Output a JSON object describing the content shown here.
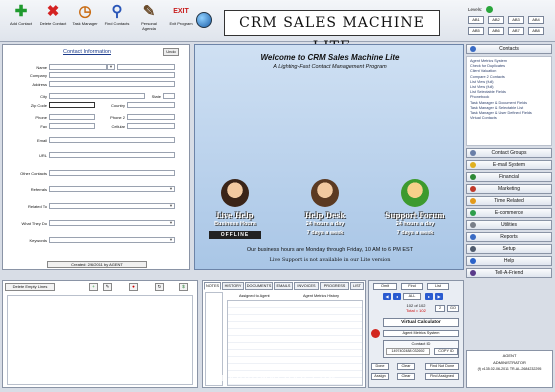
{
  "toolbar": {
    "buttons": [
      {
        "label": "Add Contact",
        "icon": "plus-icon",
        "color": "#1f9a2e"
      },
      {
        "label": "Delete Contact",
        "icon": "x-icon",
        "color": "#d42222"
      },
      {
        "label": "Task Manager",
        "icon": "clock-icon",
        "color": "#c96b12"
      },
      {
        "label": "Find Contacts",
        "icon": "magnifier-icon",
        "color": "#2a56b8"
      },
      {
        "label": "Personal Agenda",
        "icon": "agenda-icon",
        "color": "#6a4b2a"
      },
      {
        "label": "Exit Program",
        "icon": "exit-icon",
        "color": "#c81c1c"
      }
    ],
    "exit_icon_text": "EXIT",
    "brand": "CRM SALES MACHINE LITE"
  },
  "levels": {
    "label": "Levels:",
    "buttons": [
      "AB1",
      "AB2",
      "AB3",
      "AB4",
      "AB5",
      "AB6",
      "AB7",
      "AB8"
    ]
  },
  "form": {
    "title": "Contact Information",
    "undo": "Undo",
    "labels": {
      "name": "Name",
      "company": "Company",
      "address": "Address",
      "city": "City",
      "state": "State",
      "zip": "Zip Code",
      "country": "Country",
      "phone": "Phone",
      "phone2": "Phone 2",
      "fax": "Fax",
      "cellular": "Cellular",
      "email": "Email",
      "url": "URL",
      "other": "Other Contacts",
      "referrals": "Referrals",
      "related": "Related To",
      "whatdo": "What They Do",
      "keywords": "Keywords"
    },
    "created": "Created: 2/6/2011 by AGENT"
  },
  "welcome": {
    "title": "Welcome to CRM Sales Machine Lite",
    "subtitle": "A Lighting-Fast Contact Management Program",
    "live_help": {
      "title": "Live Help",
      "line1": "Business Hours",
      "status": "OFFLINE"
    },
    "help_desk": {
      "title": "Help Desk",
      "line1": "24 hours a day",
      "line2": "7 days a week"
    },
    "support_forum": {
      "title": "Support Forum",
      "line1": "24 hours a day",
      "line2": "7 days a week"
    },
    "hours": "Our business hours are Monday through Friday, 10 AM to 6 PM EST",
    "live_note": "Live Support is not available in our Lite version"
  },
  "sidebar": {
    "contacts": "Contacts",
    "contact_items": [
      "Agent Metrics System",
      "Check for Duplicates",
      "Client Valuation",
      "Compare 2 Contacts",
      "List View (full)",
      "List View (full)",
      "List Selectable Fields",
      "Phonebook",
      "Task Manager & Document Fields",
      "Task Manager & Selectable List",
      "Task Manager & User Defined Fields",
      "Virtual Contacts"
    ],
    "buttons": [
      {
        "label": "Contact Groups",
        "color": "#6a7fa8"
      },
      {
        "label": "E-mail System",
        "color": "#e0b020"
      },
      {
        "label": "Financial",
        "color": "#2e8a36"
      },
      {
        "label": "Marketing",
        "color": "#c0392b"
      },
      {
        "label": "Time Related",
        "color": "#e39a1a"
      },
      {
        "label": "E-commerce",
        "color": "#2e9e4a"
      },
      {
        "label": "Utilities",
        "color": "#7a7f89"
      },
      {
        "label": "Reports",
        "color": "#3a6bc4"
      },
      {
        "label": "Setup",
        "color": "#4f5b6e"
      },
      {
        "label": "Help",
        "color": "#2b63c9"
      },
      {
        "label": "Tell-A-Friend",
        "color": "#5a3a8a"
      }
    ]
  },
  "bottom_left": {
    "delete_lines": "Delete Empty Lines",
    "mini_buttons": [
      "+",
      "✎",
      "●",
      "↻",
      "$"
    ]
  },
  "notes": {
    "tabs": [
      "NOTES",
      "HISTORY",
      "DOCUMENTS",
      "EMAILS",
      "INVOICES",
      "PROGRESS",
      "LIST"
    ],
    "col_assigned": "Assigned to Agent",
    "col_metrics": "Agent Metrics History"
  },
  "controls": {
    "omit": "Omit",
    "find": "Find",
    "list": "List",
    "all": "ALL",
    "record": "102 of 102",
    "total": "Total = 102",
    "go_value": "2",
    "go": "GO",
    "virtual_calc": "Virtual Calculator",
    "agent_metrics": "Agent Metrics System",
    "contact_id_label": "Contact ID",
    "contact_id": "1497402488 032692",
    "copy_id": "COPY ID",
    "done": "Done",
    "clear": "Clear",
    "find_not_done": "Find Not Done",
    "assign": "Assign",
    "clear2": "Clear",
    "find_assigned": "Find Assigned"
  },
  "user": {
    "agent": "AGENT",
    "role": "ADMINISTRATOR",
    "version": "(f) v135.02-06-2011 TR-AL-2684232295"
  },
  "watermark": "GEARDOWNLOAD.COM"
}
